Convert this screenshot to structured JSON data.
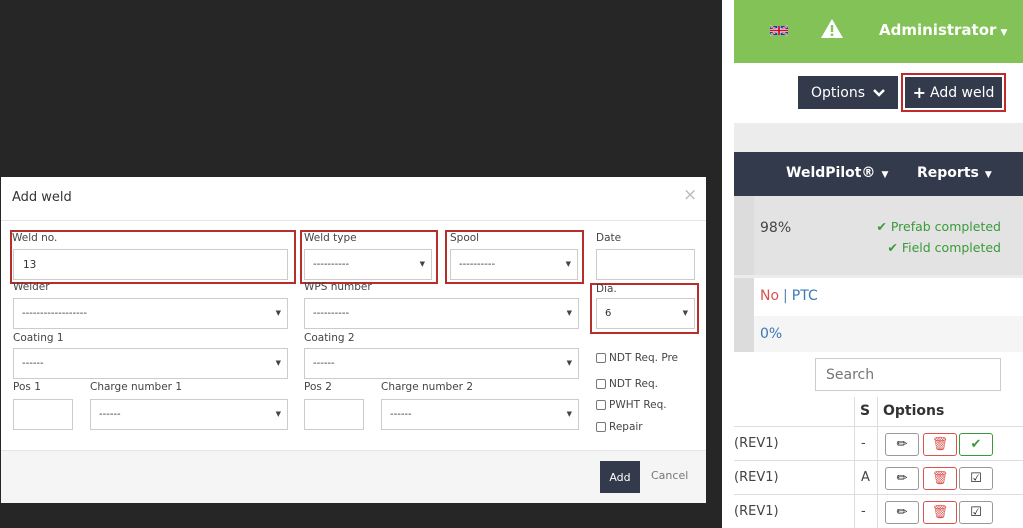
{
  "header": {
    "admin_label": "Administrator",
    "flag_icon": "uk-flag-icon",
    "warning_icon": "warning-icon"
  },
  "toolbar": {
    "options_label": "Options",
    "add_weld_label": "Add weld"
  },
  "nav": {
    "weldpilot": "WeldPilot®",
    "reports": "Reports"
  },
  "summary": {
    "percent": "98%",
    "prefab": "Prefab completed",
    "field": "Field completed",
    "no": "No",
    "sep": "|",
    "ptc": "PTC",
    "zero": "0%"
  },
  "search": {
    "placeholder": "Search"
  },
  "table": {
    "headers": {
      "s": "S",
      "options": "Options"
    },
    "rows": [
      {
        "ref": "(REV1)",
        "s": "-"
      },
      {
        "ref": "(REV1)",
        "s": "A"
      },
      {
        "ref": "(REV1)",
        "s": "-"
      }
    ]
  },
  "modal": {
    "title": "Add weld",
    "close": "×",
    "fields": {
      "weld_no": {
        "label": "Weld no.",
        "value": "13"
      },
      "weld_type": {
        "label": "Weld type",
        "value": "----------"
      },
      "spool": {
        "label": "Spool",
        "value": "----------"
      },
      "date": {
        "label": "Date",
        "value": ""
      },
      "welder": {
        "label": "Welder",
        "value": "------------------"
      },
      "wps_number": {
        "label": "WPS number",
        "value": "----------"
      },
      "dia": {
        "label": "Dia.",
        "value": "6"
      },
      "coating1": {
        "label": "Coating 1",
        "value": "------"
      },
      "coating2": {
        "label": "Coating 2",
        "value": "------"
      },
      "pos1": {
        "label": "Pos 1",
        "value": ""
      },
      "charge1": {
        "label": "Charge number 1",
        "value": "------"
      },
      "pos2": {
        "label": "Pos 2",
        "value": ""
      },
      "charge2": {
        "label": "Charge number 2",
        "value": "------"
      }
    },
    "checkboxes": {
      "ndt_pre": "NDT Req. Pre",
      "ndt": "NDT Req.",
      "pwht": "PWHT Req.",
      "repair": "Repair"
    },
    "add_label": "Add",
    "cancel_label": "Cancel"
  },
  "colors": {
    "topbar": "#82c256",
    "dark_button": "#333a4b",
    "highlight_red": "#b5302a",
    "success_green": "#3a9a3a",
    "danger_red": "#d9534f",
    "link_blue": "#3a77b5"
  }
}
